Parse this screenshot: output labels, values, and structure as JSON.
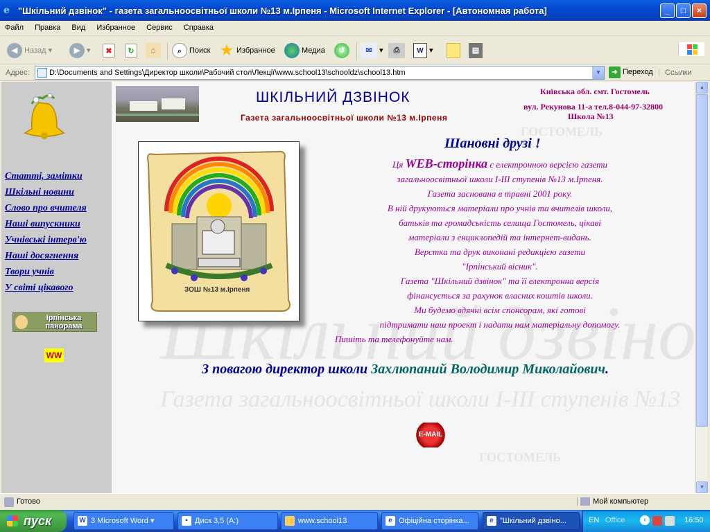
{
  "window": {
    "title": "\"Шкільний дзвінок\" - газета загальноосвітньої школи №13 м.Ірпеня - Microsoft Internet Explorer - [Автономная работа]"
  },
  "menu": [
    "Файл",
    "Правка",
    "Вид",
    "Избранное",
    "Сервис",
    "Справка"
  ],
  "toolbar": {
    "back": "Назад",
    "search": "Поиск",
    "favorites": "Избранное",
    "media": "Медиа"
  },
  "address": {
    "label": "Адрес:",
    "value": "D:\\Documents and Settings\\Директор школи\\Рабочий стол\\Лекції\\www.school13\\schooldz\\school13.htm",
    "go": "Переход",
    "links": "Ссылки"
  },
  "page": {
    "nav": [
      "Статті, замітки",
      "Шкільні новини",
      "Слово про вчителя",
      "Наші випускники",
      "Учнівські інтерв'ю",
      "Наші досягнення",
      "Твори учнів",
      "У світі цікавого"
    ],
    "irpin_banner": "Ірпінська панорама",
    "ww_logo": "WW",
    "header_title": "ШКІЛЬНИЙ ДЗВІНОК",
    "header_subtitle": "Газета загальноосвітньої школи №13 м.Ірпеня",
    "header_right_1": "Київська обл. смт. Гостомель",
    "header_right_2": "вул. Рекунова 11-а тел.8-044-97-32800",
    "header_right_3": "Школа №13",
    "emblem_caption": "ЗОШ №13 м.Ірпеня",
    "greeting": "Шановні друзі !",
    "intro_a": "Ця ",
    "intro_b": "WEB-сторінка",
    "intro_c": " є електронною версією газети",
    "body_lines": [
      "загальноосвітньої школи І-ІІІ ступенів №13 м.Ірпеня.",
      "Газета заснована в травні 2001 року.",
      "В ній друкуються матеріали про учнів та вчителів школи,",
      "батьків та громадськість селища Гостомель, цікаві",
      "матеріали з енциклопедій та інтернет-видань.",
      "Верстка та друк виконані редакцією газети",
      "\"Ірпінський вісник\".",
      "Газета \"Шкільний дзвінок\" та її електронна версія",
      "фінансується за рахунок власних коштів школи.",
      "Ми будемо вдячні всім спонсорам, які готові",
      "підтримати наш проект і надати нам матеріальну допомогу.",
      "Пишіть та телефонуйте нам."
    ],
    "signature_prefix": "З повагою директор школи ",
    "signature_name": "Захлюпаний Володимир Миколайович",
    "signature_end": ".",
    "email_label": "E-MAIL",
    "watermark_1": "Шкільний дзвінок",
    "watermark_2": "Газета загальноосвітньої школи І-ІІІ ступенів №13",
    "watermark_3": "ГОСТОМЕЛЬ"
  },
  "status": {
    "left": "Готово",
    "right": "Мой компьютер"
  },
  "taskbar": {
    "start": "пуск",
    "tasks": [
      "3 Microsoft Word",
      "Диск 3,5 (A:)",
      "www.school13",
      "Офіційна сторінка...",
      "\"Шкільний дзвіно..."
    ],
    "lang": "EN",
    "office": "Office",
    "clock": "16:50"
  },
  "colors": {
    "nav": "#000099",
    "body_text": "#990099",
    "title": "#000099",
    "subtitle": "#990000",
    "signature_name": "#006666"
  }
}
